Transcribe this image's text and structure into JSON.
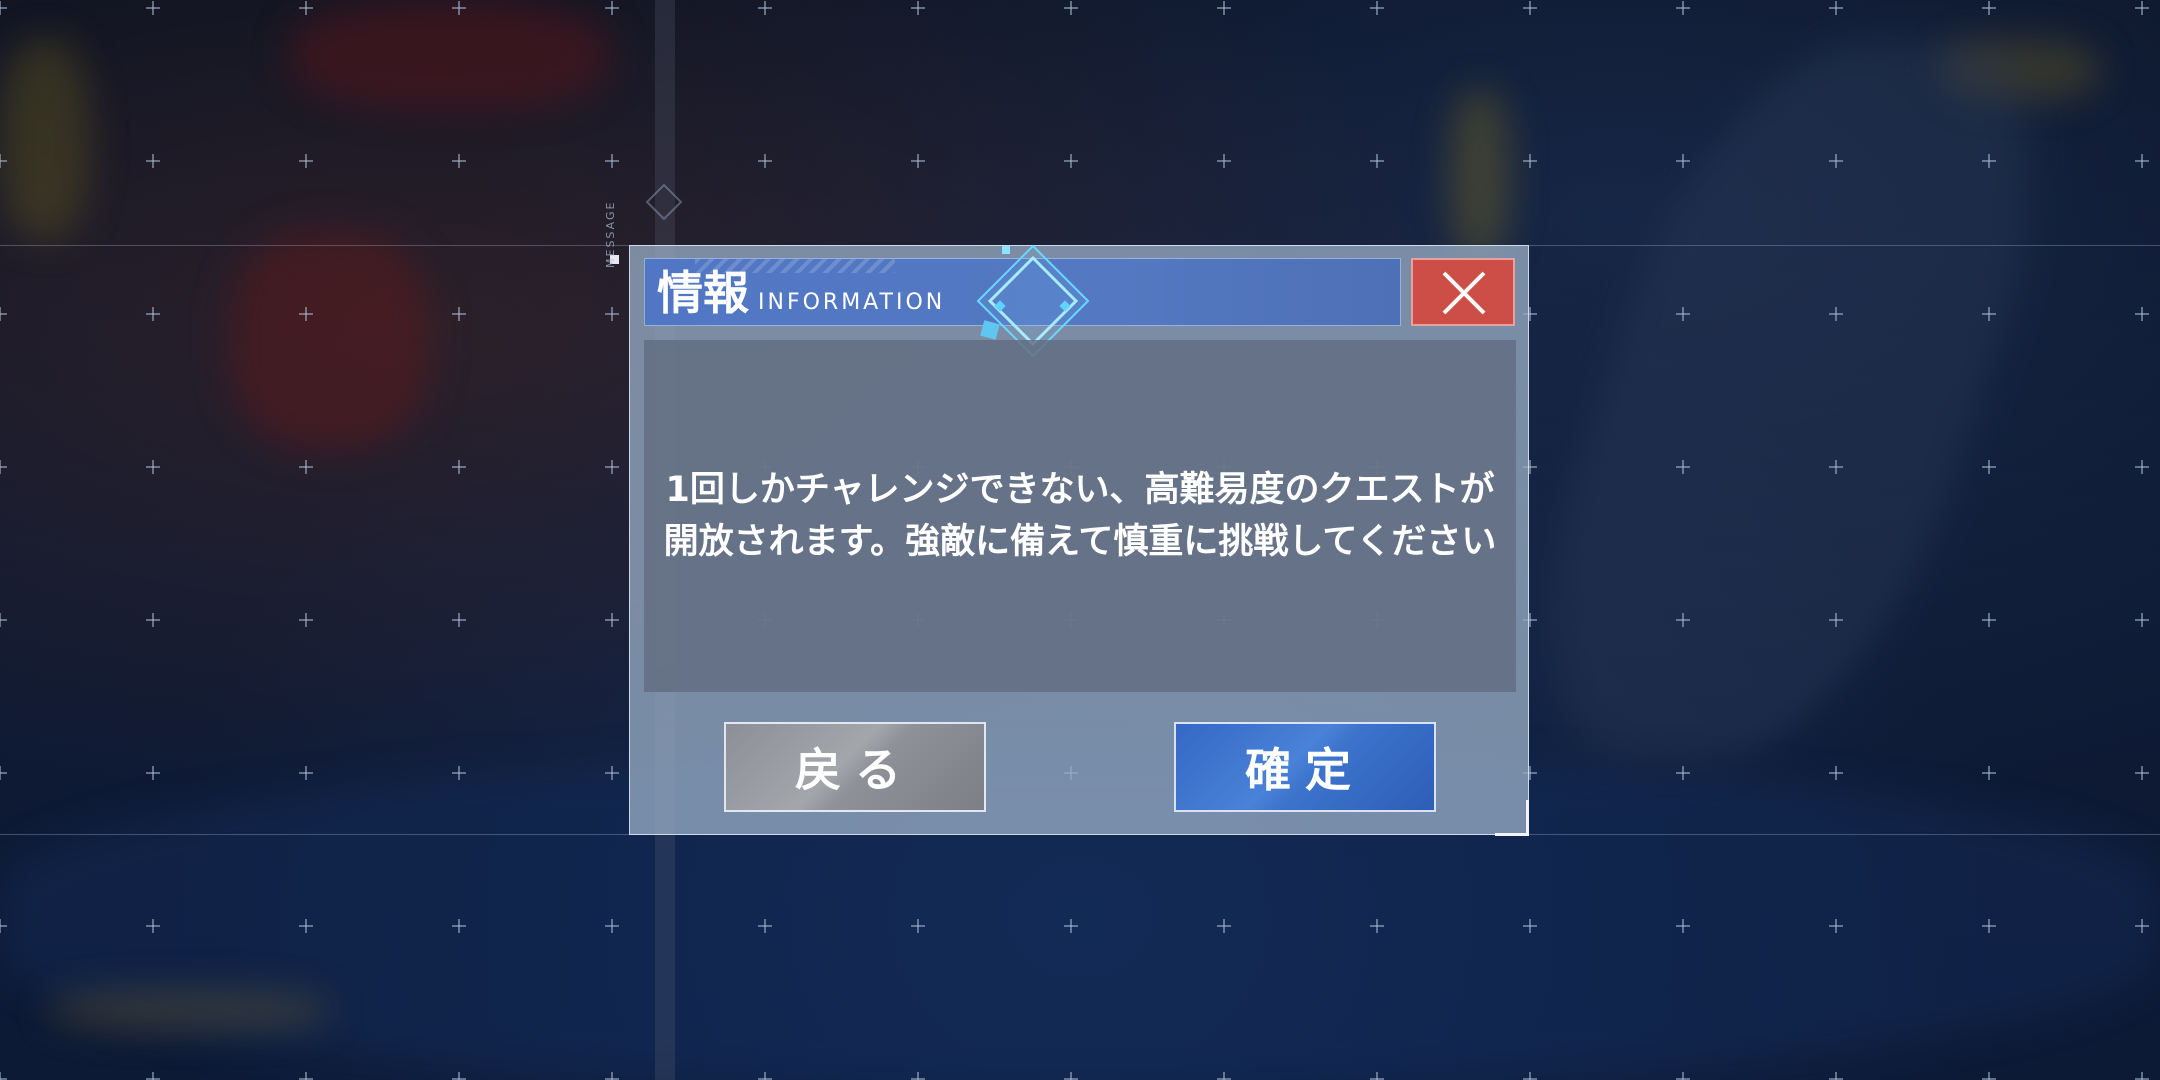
{
  "background": {
    "side_label": "MESSAGE"
  },
  "dialog": {
    "title": "情報",
    "title_sub": "INFORMATION",
    "close_icon": "close-x-icon",
    "message_line1": "1回しかチャレンジできない、高難易度のクエストが",
    "message_line2": "開放されます。強敵に備えて慎重に挑戦してください",
    "back_label": "戻る",
    "confirm_label": "確定",
    "colors": {
      "title_bar": "#5177c4",
      "close_button": "#cc4e47",
      "confirm_button": "#3c73cc",
      "back_button": "#9a9da2"
    }
  }
}
